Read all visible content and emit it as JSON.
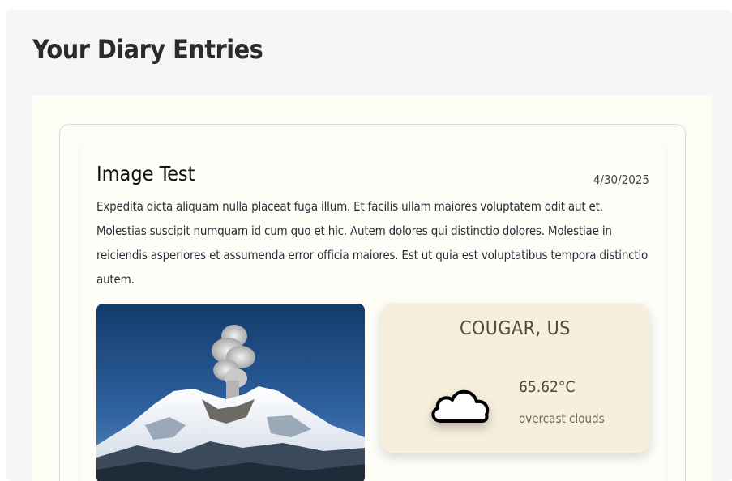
{
  "page": {
    "title": "Your Diary Entries"
  },
  "entries": [
    {
      "title": "Image Test",
      "date": "4/30/2025",
      "body": "Expedita dicta aliquam nulla placeat fuga illum. Et facilis ullam maiores voluptatem odit aut et. Molestias suscipit numquam id cum quo et hic. Autem dolores qui distinctio dolores. Molestiae in reiciendis asperiores et assumenda error officia maiores. Est ut quia est voluptatibus tempora distinctio autem.",
      "image_icon": "volcano-photo",
      "weather": {
        "location": "COUGAR, US",
        "temperature": "65.62°C",
        "description": "overcast clouds",
        "icon": "cloud-icon"
      }
    }
  ],
  "colors": {
    "page_bg": "#f5f5f5",
    "panel_bg": "#fdfcf5",
    "weather_card_bg": "#f6efdc",
    "title_color": "#2b2b2b",
    "weather_text": "#5a4330"
  }
}
